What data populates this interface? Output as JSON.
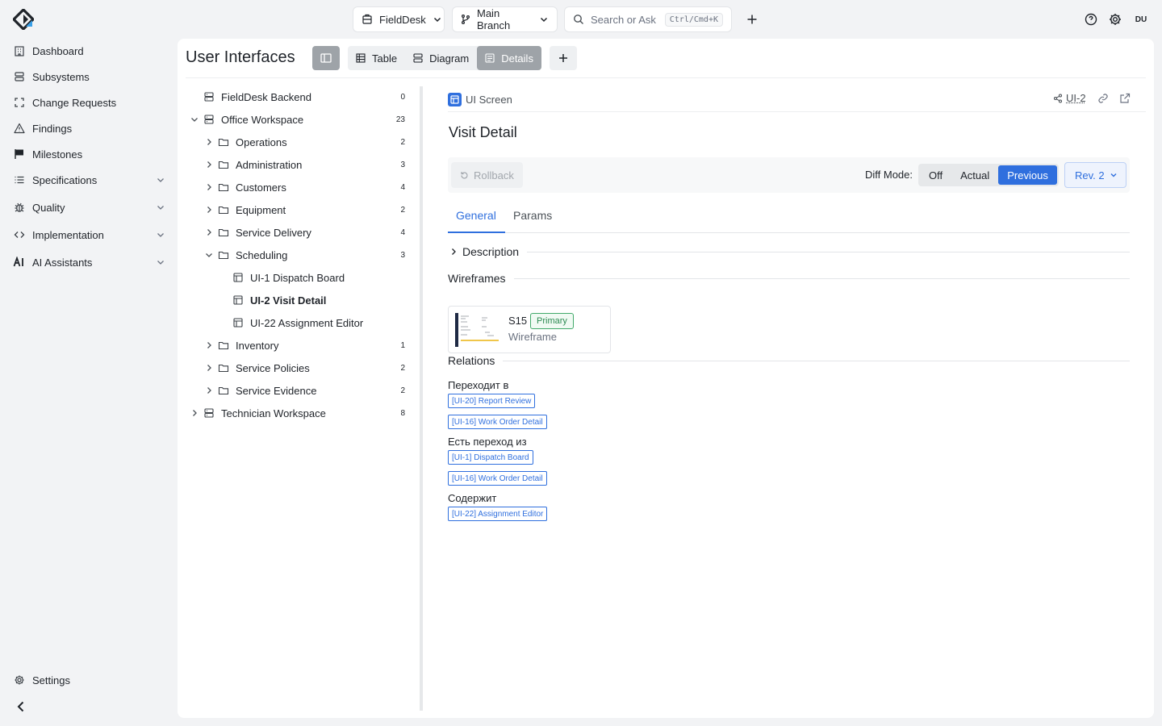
{
  "sidebar": {
    "items": [
      {
        "label": "Dashboard"
      },
      {
        "label": "Subsystems"
      },
      {
        "label": "Change Requests"
      },
      {
        "label": "Findings"
      },
      {
        "label": "Milestones"
      },
      {
        "label": "Specifications"
      },
      {
        "label": "Quality"
      },
      {
        "label": "Implementation"
      },
      {
        "label": "AI Assistants"
      }
    ],
    "settings_label": "Settings"
  },
  "topbar": {
    "project": "FieldDesk",
    "branch": "Main Branch",
    "search_placeholder": "Search or Ask",
    "search_shortcut": "Ctrl/Cmd+K",
    "user_initials": "DU"
  },
  "page": {
    "title": "User Interfaces",
    "views": [
      {
        "label": "Table"
      },
      {
        "label": "Diagram"
      },
      {
        "label": "Details"
      }
    ]
  },
  "tree": {
    "items": [
      {
        "label": "FieldDesk Backend",
        "count": "0"
      },
      {
        "label": "Office Workspace",
        "count": "23"
      },
      {
        "label": "Operations",
        "count": "2"
      },
      {
        "label": "Administration",
        "count": "3"
      },
      {
        "label": "Customers",
        "count": "4"
      },
      {
        "label": "Equipment",
        "count": "2"
      },
      {
        "label": "Service Delivery",
        "count": "4"
      },
      {
        "label": "Scheduling",
        "count": "3"
      },
      {
        "label": "UI-1 Dispatch Board"
      },
      {
        "label": "UI-2 Visit Detail"
      },
      {
        "label": "UI-22 Assignment Editor"
      },
      {
        "label": "Inventory",
        "count": "1"
      },
      {
        "label": "Service Policies",
        "count": "2"
      },
      {
        "label": "Service Evidence",
        "count": "2"
      },
      {
        "label": "Technician Workspace",
        "count": "8"
      }
    ]
  },
  "detail": {
    "type_label": "UI Screen",
    "id": "UI-2",
    "title": "Visit Detail",
    "rollback_label": "Rollback",
    "diff_mode_label": "Diff Mode:",
    "diff_options": [
      "Off",
      "Actual",
      "Previous"
    ],
    "diff_selected": "Previous",
    "revision": "Rev. 2",
    "tabs": [
      "General",
      "Params"
    ],
    "sections": {
      "description": "Description",
      "wireframes": "Wireframes",
      "relations": "Relations"
    },
    "wireframe": {
      "name": "S15",
      "badge": "Primary",
      "type": "Wireframe"
    },
    "relations": [
      {
        "label": "Переходит в",
        "links": [
          "[UI-20] Report Review",
          "[UI-16] Work Order Detail"
        ]
      },
      {
        "label": "Есть переход из",
        "links": [
          "[UI-1] Dispatch Board",
          "[UI-16] Work Order Detail"
        ]
      },
      {
        "label": "Содержит",
        "links": [
          "[UI-22] Assignment Editor"
        ]
      }
    ]
  },
  "colors": {
    "accent": "#2f6fde",
    "success": "#2c8a52",
    "active_view_bg": "#9ea3a8"
  }
}
